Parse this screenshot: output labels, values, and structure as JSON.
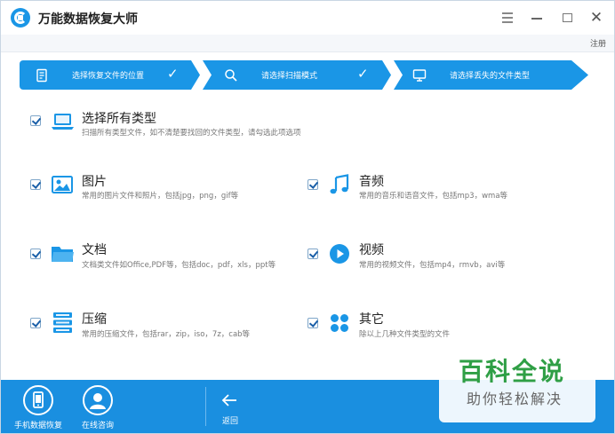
{
  "window": {
    "title": "万能数据恢复大师",
    "register": "注册"
  },
  "steps": [
    {
      "label": "选择恢复文件的位置",
      "icon": "document-icon",
      "done": true
    },
    {
      "label": "请选择扫描模式",
      "icon": "search-icon",
      "done": true
    },
    {
      "label": "请选择丢失的文件类型",
      "icon": "monitor-icon",
      "done": false
    }
  ],
  "options": {
    "all": {
      "title": "选择所有类型",
      "desc": "扫描所有类型文件，如不清楚要找回的文件类型，请勾选此项选项",
      "checked": true,
      "icon": "laptop-icon"
    },
    "image": {
      "title": "图片",
      "desc": "常用的图片文件和照片，包括jpg，png，gif等",
      "checked": true,
      "icon": "image-icon"
    },
    "audio": {
      "title": "音频",
      "desc": "常用的音乐和语音文件，包括mp3，wma等",
      "checked": true,
      "icon": "music-icon"
    },
    "document": {
      "title": "文档",
      "desc": "文档类文件如Office,PDF等，包括doc，pdf，xls，ppt等",
      "checked": true,
      "icon": "folder-icon"
    },
    "video": {
      "title": "视频",
      "desc": "常用的视频文件，包括mp4，rmvb，avi等",
      "checked": true,
      "icon": "play-icon"
    },
    "archive": {
      "title": "压缩",
      "desc": "常用的压缩文件，包括rar，zip，iso，7z，cab等",
      "checked": true,
      "icon": "archive-icon"
    },
    "other": {
      "title": "其它",
      "desc": "除以上几种文件类型的文件",
      "checked": true,
      "icon": "grid-icon"
    }
  },
  "bottom": {
    "phone_recovery": "手机数据恢复",
    "online_consult": "在线咨询",
    "back": "返回"
  },
  "watermark": {
    "main": "百科全说",
    "sub": "助你轻松解决"
  },
  "colors": {
    "accent": "#1a96e6",
    "bottom_bar": "#1a8fe0",
    "watermark_green": "#2f9f45"
  }
}
